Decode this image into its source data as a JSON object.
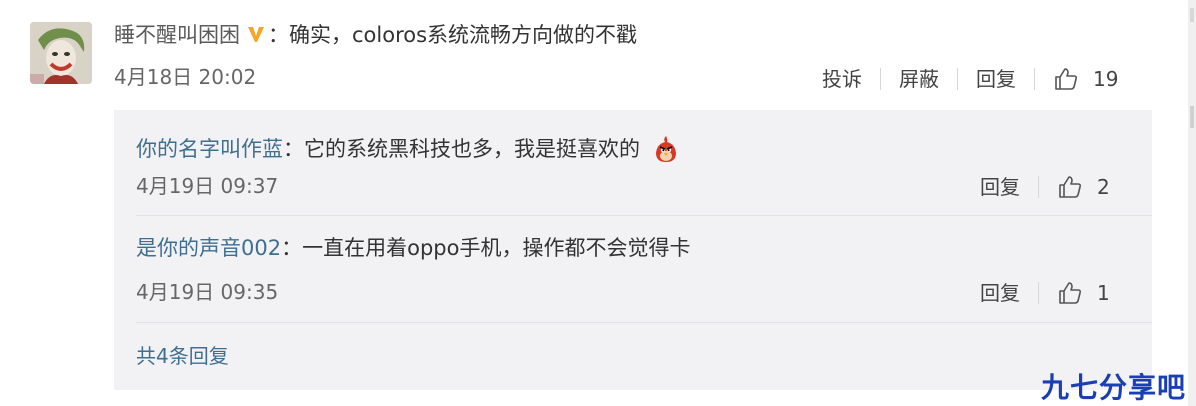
{
  "main_comment": {
    "user_name": "睡不醒叫困困",
    "badge_icon": "verified-v-icon",
    "badge_color": "#f5a623",
    "separator": "：",
    "text": "确实，coloros系统流畅方向做的不戳",
    "date": "4月18日 20:02",
    "actions": {
      "report_label": "投诉",
      "block_label": "屏蔽",
      "reply_label": "回复",
      "like_count": "19"
    }
  },
  "replies": [
    {
      "user_name": "你的名字叫作蓝",
      "separator": "：",
      "text": "它的系统黑科技也多，我是挺喜欢的",
      "emoji": "red-bird-emoji",
      "date": "4月19日 09:37",
      "reply_label": "回复",
      "like_count": "2"
    },
    {
      "user_name": "是你的声音002",
      "separator": "：",
      "text": "一直在用着oppo手机，操作都不会觉得卡",
      "date": "4月19日 09:35",
      "reply_label": "回复",
      "like_count": "1"
    }
  ],
  "total_replies_label": "共4条回复",
  "watermark_text": "九七分享吧",
  "colors": {
    "link_blue": "#3f6f8f",
    "reply_panel_bg": "#f2f2f5",
    "watermark_blue": "#1a3fb5"
  }
}
